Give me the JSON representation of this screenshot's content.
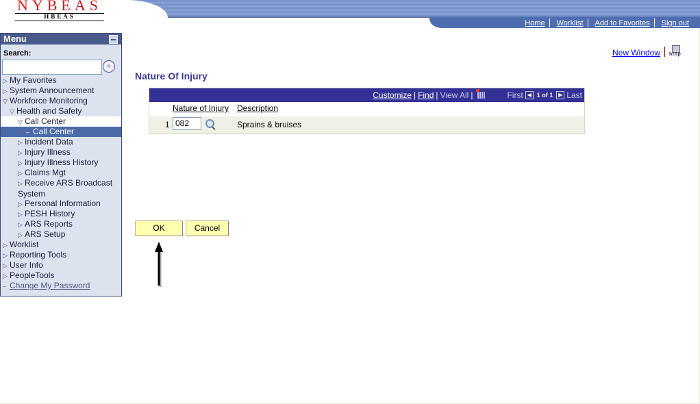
{
  "header": {
    "logo_main": "NYBEAS",
    "logo_sub": "HBEAS",
    "nav": [
      {
        "label": "Home"
      },
      {
        "label": "Worklist"
      },
      {
        "label": "Add to Favorites"
      },
      {
        "label": "Sign out"
      }
    ]
  },
  "menu": {
    "title": "Menu",
    "search_label": "Search:",
    "search_value": "",
    "items": [
      {
        "label": "My Favorites",
        "icon": "triangle-right"
      },
      {
        "label": "System Announcement",
        "icon": "triangle-right"
      },
      {
        "label": "Workforce Monitoring",
        "icon": "triangle-down"
      },
      {
        "label": "Health and Safety",
        "icon": "triangle-down"
      },
      {
        "label": "Call Center",
        "icon": "triangle-down"
      },
      {
        "label": "Call Center",
        "icon": "dash"
      },
      {
        "label": "Incident Data",
        "icon": "triangle-right"
      },
      {
        "label": "Injury Illness",
        "icon": "triangle-right"
      },
      {
        "label": "Injury Illness History",
        "icon": "triangle-right"
      },
      {
        "label": "Claims Mgt",
        "icon": "triangle-right"
      },
      {
        "label": "Receive ARS Broadcast System",
        "icon": "triangle-right"
      },
      {
        "label": "Personal Information",
        "icon": "triangle-right"
      },
      {
        "label": "PESH History",
        "icon": "triangle-right"
      },
      {
        "label": "ARS Reports",
        "icon": "triangle-right"
      },
      {
        "label": "ARS Setup",
        "icon": "triangle-right"
      },
      {
        "label": "Worklist",
        "icon": "triangle-right"
      },
      {
        "label": "Reporting Tools",
        "icon": "triangle-right"
      },
      {
        "label": "User Info",
        "icon": "triangle-right"
      },
      {
        "label": "PeopleTools",
        "icon": "triangle-right"
      },
      {
        "label": "Change My Password",
        "icon": "dash"
      }
    ]
  },
  "content": {
    "new_window": "New Window",
    "http_label": "http",
    "page_title": "Nature Of Injury",
    "grid": {
      "customize": "Customize",
      "find": "Find",
      "view_all": "View All",
      "first": "First",
      "page_count": "1 of 1",
      "last": "Last",
      "columns": [
        "Nature of Injury",
        "Description"
      ],
      "rows": [
        {
          "num": "1",
          "code": "082",
          "description": "Sprains & bruises"
        }
      ]
    },
    "ok_label": "OK",
    "cancel_label": "Cancel"
  }
}
